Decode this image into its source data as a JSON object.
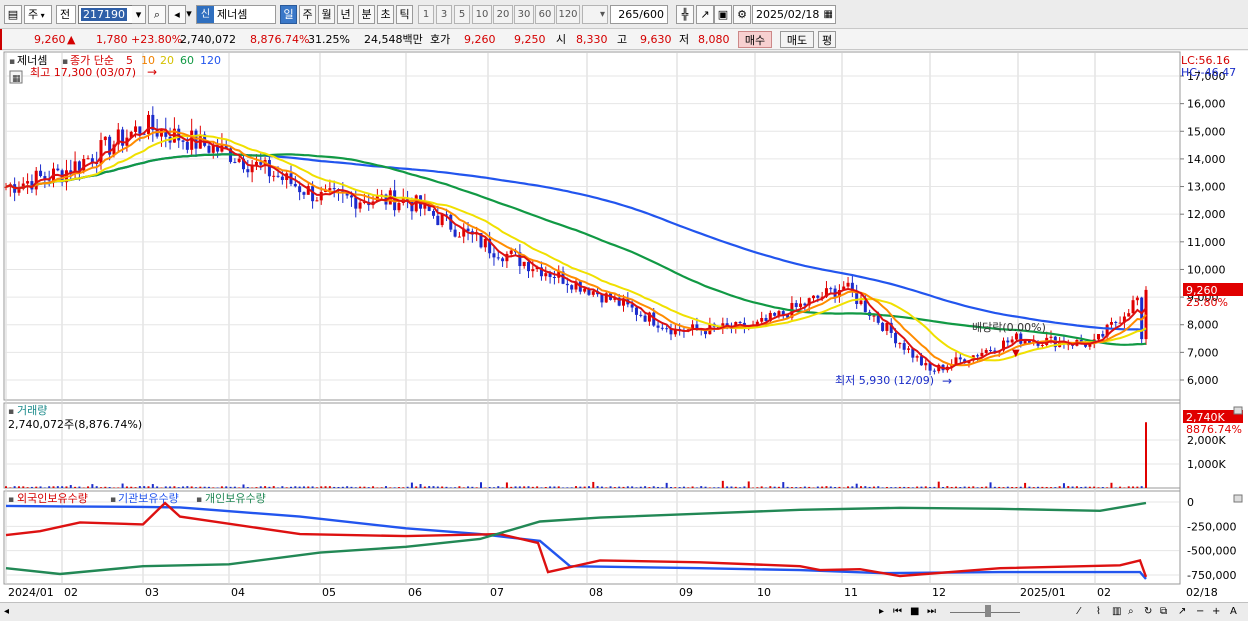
{
  "toolbar": {
    "market": "주",
    "prev": "전",
    "code": "217190",
    "name": "제너셈",
    "sin_badge": "신",
    "periods": [
      "일",
      "주",
      "월",
      "년",
      "분",
      "초",
      "틱"
    ],
    "active_period": "일",
    "numbers": [
      "1",
      "3",
      "5",
      "10",
      "20",
      "30",
      "60",
      "120"
    ],
    "count": "265",
    "count_max": "/600",
    "date": "2025/02/18"
  },
  "quote": {
    "price": "9,260",
    "change": "1,780",
    "change_pct": "+23.80%",
    "volume": "2,740,072",
    "volume_pct": "8,876.74%",
    "turnover": "31.25%",
    "amount": "24,548백만",
    "hoga_label": "호가",
    "ask": "9,260",
    "bid": "9,250",
    "open_label": "시",
    "open": "8,330",
    "high_label": "고",
    "high": "9,630",
    "low_label": "저",
    "low": "8,080",
    "buy_label": "매수",
    "sell_label": "매도",
    "avg_label": "평"
  },
  "price_pane": {
    "name": "제너셈",
    "ma_label": "종가 단순",
    "ma_periods": [
      "5",
      "10",
      "20",
      "60",
      "120"
    ],
    "max_label": "최고 17,300 (03/07)",
    "min_label": "최저 5,930 (12/09)",
    "dividend_label": "배당락(0.00%)",
    "lc_label": "LC:56.16",
    "hc_label": "HC:-46.47",
    "last_price_tag": "9,260",
    "last_pct_tag": "23.80%",
    "y_ticks": [
      "17,000",
      "16,000",
      "15,000",
      "14,000",
      "13,000",
      "12,000",
      "11,000",
      "10,000",
      "9,000",
      "8,000",
      "7,000",
      "6,000"
    ]
  },
  "volume_pane": {
    "title": "거래량",
    "value": "2,740,072주(8,876.74%)",
    "tag_value": "2,740K",
    "tag_pct": "8876.74%",
    "y_ticks": [
      "2,000K",
      "1,000K"
    ]
  },
  "holdings_pane": {
    "legend": [
      "외국인보유수량",
      "기관보유수량",
      "개인보유수량"
    ],
    "y_ticks": [
      "0",
      "-250,000",
      "-500,000",
      "-750,000"
    ]
  },
  "x_axis": {
    "labels": [
      "2024/01",
      "02",
      "03",
      "04",
      "05",
      "06",
      "07",
      "08",
      "09",
      "10",
      "11",
      "12",
      "2025/01",
      "02"
    ],
    "last_date": "02/18"
  },
  "colors": {
    "up": "#e00000",
    "down": "#1c2ccc",
    "ma5": "#dd1111",
    "ma10": "#ff8c00",
    "ma20": "#f0e000",
    "ma60": "#119944",
    "ma120": "#2255ee",
    "foreign": "#dd1111",
    "institution": "#2255ee",
    "individual": "#228855"
  },
  "chart_data": {
    "type": "line",
    "title": "",
    "xlabel": "",
    "ylabel": "",
    "ylim": [
      5500,
      17300
    ],
    "x": [
      "2024/01",
      "02",
      "03",
      "04",
      "05",
      "06",
      "07",
      "08",
      "09",
      "10",
      "11",
      "12",
      "2025/01",
      "02",
      "02/18"
    ],
    "series": [
      {
        "name": "종가",
        "values": [
          13000,
          13500,
          15200,
          14200,
          12600,
          12500,
          10800,
          9300,
          7800,
          7900,
          9400,
          6300,
          7500,
          7300,
          9260
        ]
      },
      {
        "name": "120",
        "values": [
          12800,
          12900,
          13000,
          13300,
          13500,
          13500,
          13000,
          12100,
          11000,
          10300,
          9700,
          8800,
          8200,
          8000,
          7900
        ]
      },
      {
        "name": "60",
        "values": [
          12500,
          13200,
          13800,
          14200,
          13800,
          13200,
          12300,
          11000,
          9600,
          8600,
          8200,
          8000,
          7600,
          7400,
          7400
        ]
      }
    ],
    "volume_max": "2,740,072"
  }
}
